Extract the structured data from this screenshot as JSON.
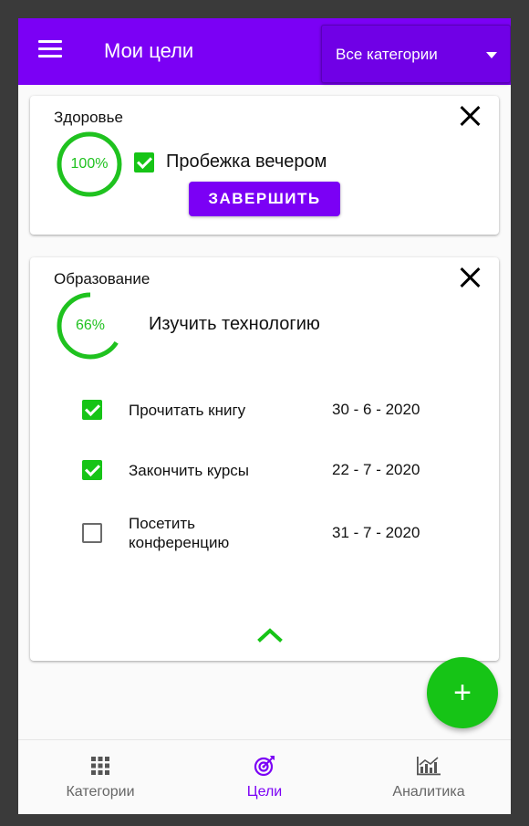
{
  "appbar": {
    "title": "Мои цели",
    "category_filter": "Все категории"
  },
  "goals": [
    {
      "category": "Здоровье",
      "progress": 100,
      "progress_label": "100%",
      "title": "Пробежка вечером",
      "checked": true,
      "finish_label": "ЗАВЕРШИТЬ"
    },
    {
      "category": "Образование",
      "progress": 66,
      "progress_label": "66%",
      "title": "Изучить технологию",
      "subtasks": [
        {
          "label": "Прочитать книгу",
          "date": "30 - 6 - 2020",
          "checked": true
        },
        {
          "label": "Закончить курсы",
          "date": "22 - 7 - 2020",
          "checked": true
        },
        {
          "label_line1": "Посетить",
          "label_line2": "конференцию",
          "date": "31 - 7 - 2020",
          "checked": false
        }
      ]
    }
  ],
  "fab": {
    "symbol": "+"
  },
  "bottom_nav": {
    "items": [
      {
        "label": "Категории",
        "icon": "grid-icon",
        "active": false
      },
      {
        "label": "Цели",
        "icon": "target-icon",
        "active": true
      },
      {
        "label": "Аналитика",
        "icon": "chart-icon",
        "active": false
      }
    ]
  },
  "colors": {
    "primary": "#7b00f5",
    "accent_green": "#16c416"
  }
}
